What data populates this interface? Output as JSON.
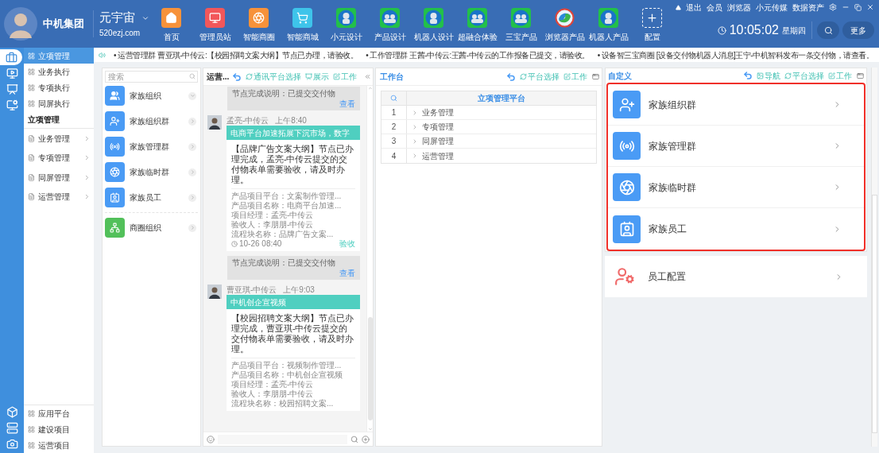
{
  "header": {
    "company": "中机集团",
    "product": "元宇宙",
    "domain": "520ezj.com",
    "apps": [
      {
        "label": "首页",
        "kind": "home"
      },
      {
        "label": "管理员站",
        "kind": "admin"
      },
      {
        "label": "智能商圈",
        "kind": "aperture"
      },
      {
        "label": "智能商城",
        "kind": "cart"
      },
      {
        "label": "小元设计",
        "kind": "robot"
      },
      {
        "label": "产品设计",
        "kind": "robots"
      },
      {
        "label": "机器人设计",
        "kind": "robot"
      },
      {
        "label": "超融合体验",
        "kind": "robots"
      },
      {
        "label": "三宝产品",
        "kind": "robots"
      },
      {
        "label": "浏览器产品",
        "kind": "browser"
      },
      {
        "label": "机器人产品",
        "kind": "robot"
      },
      {
        "label": "配置",
        "kind": "add"
      }
    ],
    "links": [
      "退出",
      "会员",
      "浏览器",
      "小元传媒",
      "数据资产"
    ],
    "time": "10:05:02",
    "weekday": "星期四",
    "more_button": "更多"
  },
  "rail": {
    "top": [
      {
        "kind": "briefcase",
        "selected": true
      },
      {
        "kind": "monitor",
        "selected": false
      },
      {
        "kind": "screen",
        "selected": false
      },
      {
        "kind": "monitor-cog",
        "selected": false
      }
    ],
    "bottom": [
      {
        "kind": "box"
      },
      {
        "kind": "server"
      },
      {
        "kind": "camera"
      }
    ]
  },
  "sidebar": {
    "exec_items": [
      {
        "label": "立项管理",
        "selected": true
      },
      {
        "label": "业务执行",
        "selected": false
      },
      {
        "label": "专项执行",
        "selected": false
      },
      {
        "label": "同屏执行",
        "selected": false
      }
    ],
    "section_title": "立项管理",
    "manage_items": [
      "业务管理",
      "专项管理",
      "同屏管理",
      "运营管理"
    ],
    "bottom_items": [
      "应用平台",
      "建设项目",
      "运营项目"
    ]
  },
  "ticker": [
    "• 运营管理群 曹亚琪-中传云:【校园招聘文案大纲】节点已办理，请验收。",
    "• 工作管理群 王茜-中传云:王茜-中传云的工作报备已提交，请验收。",
    "• 设备智三宝商圈 [设备交付物机器人消息]王宁-中机智科发布一条交付物，请查看。"
  ],
  "groups_panel": {
    "placeholder": "搜索",
    "items": [
      {
        "label": "家族组织",
        "kind": "team",
        "color": "#4a9bf5",
        "expanded": true
      },
      {
        "label": "家族组织群",
        "kind": "user-add",
        "color": "#4a9bf5",
        "expanded": false
      },
      {
        "label": "家族管理群",
        "kind": "broadcast",
        "color": "#4a9bf5",
        "expanded": false
      },
      {
        "label": "家族临时群",
        "kind": "aperture",
        "color": "#4a9bf5",
        "expanded": false
      },
      {
        "label": "家族员工",
        "kind": "badge",
        "color": "#4a9bf5",
        "expanded": false
      }
    ],
    "circle_items": [
      {
        "label": "商圈组织",
        "kind": "network",
        "color": "#52c05a",
        "expanded": false
      }
    ]
  },
  "chat": {
    "title": "运营...",
    "actions": [
      {
        "label": "通讯平台选择",
        "kind": "refresh"
      },
      {
        "label": "展示",
        "kind": "display"
      },
      {
        "label": "工作",
        "kind": "edit"
      }
    ],
    "messages": [
      {
        "kind": "note",
        "text": "节点完成说明：已提交交付物",
        "link": "查看"
      },
      {
        "kind": "card",
        "sender": "孟亮-中传云",
        "time": "上午8:40",
        "banner": "电商平台加速拓展下沉市场，数字",
        "body": "【品牌广告文案大纲】节点已办理完成，孟亮-中传云提交的交付物表单需要验收，请及时办理。",
        "details": [
          "产品项目平台：文案制作管理...",
          "产品项目名称：电商平台加速...",
          "项目经理：孟亮-中传云",
          "验收人：李朋朋-中传云",
          "流程块名称：品牌广告文案..."
        ],
        "timestamp": "10-26 08:40",
        "action": "验收"
      },
      {
        "kind": "note",
        "text": "节点完成说明：已提交交付物",
        "link": "查看"
      },
      {
        "kind": "card",
        "sender": "曹亚琪-中传云",
        "time": "上午9:03",
        "banner": "中机创企宣视频",
        "body": "【校园招聘文案大纲】节点已办理完成，曹亚琪-中传云提交的交付物表单需要验收，请及时办理。",
        "details": [
          "产品项目平台：视频制作管理...",
          "产品项目名称：中机创企宣视频",
          "项目经理：孟亮-中传云",
          "验收人：李朋朋-中传云",
          "流程块名称：校园招聘文案..."
        ]
      }
    ]
  },
  "workbench": {
    "title": "工作台",
    "actions": [
      {
        "label": "平台选择",
        "kind": "refresh"
      },
      {
        "label": "工作",
        "kind": "edit"
      }
    ],
    "column": "立项管理平台",
    "rows": [
      {
        "index": "1",
        "label": "业务管理"
      },
      {
        "index": "2",
        "label": "专项管理"
      },
      {
        "index": "3",
        "label": "同屏管理"
      },
      {
        "index": "4",
        "label": "运营管理"
      }
    ]
  },
  "custom": {
    "title": "自定义",
    "actions": [
      {
        "label": "导航",
        "kind": "nav"
      },
      {
        "label": "平台选择",
        "kind": "refresh"
      },
      {
        "label": "工作",
        "kind": "edit"
      }
    ],
    "highlighted": true,
    "highlighted_items": [
      {
        "label": "家族组织群",
        "kind": "user-add"
      },
      {
        "label": "家族管理群",
        "kind": "broadcast"
      },
      {
        "label": "家族临时群",
        "kind": "aperture"
      },
      {
        "label": "家族员工",
        "kind": "badge"
      }
    ],
    "other_items": [
      {
        "label": "员工配置",
        "kind": "staff"
      }
    ]
  }
}
